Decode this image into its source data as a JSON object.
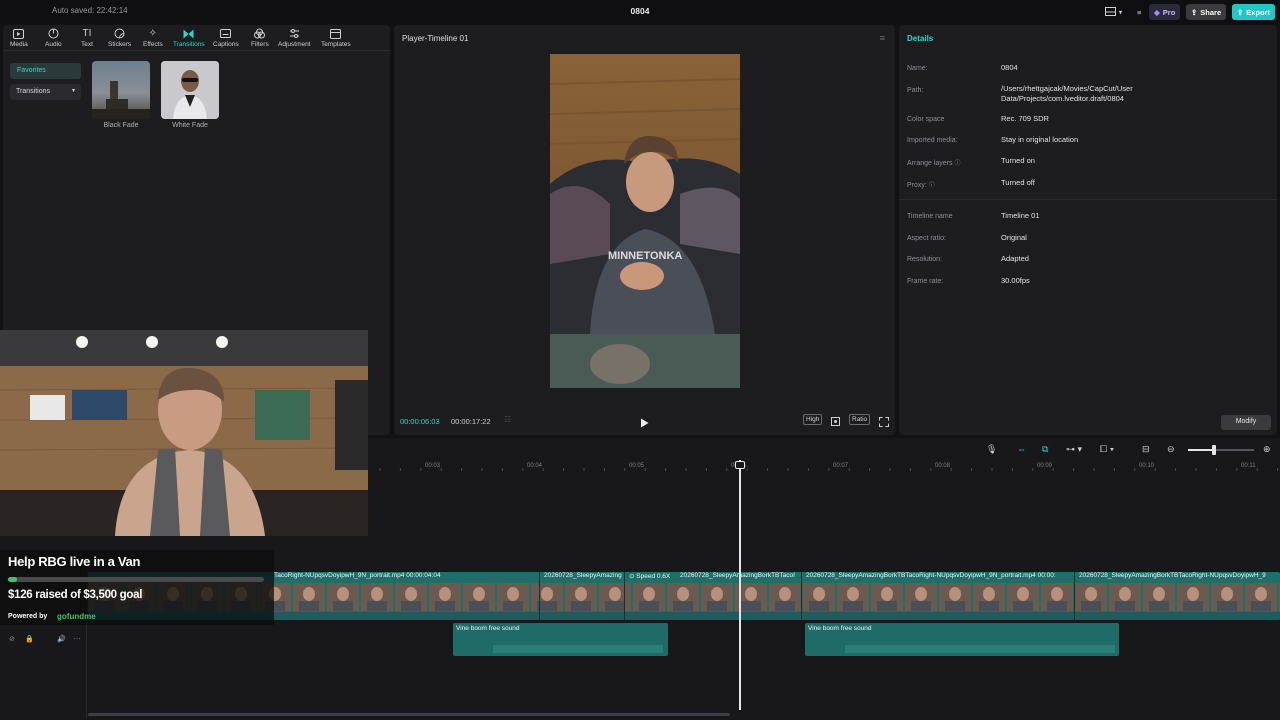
{
  "topbar": {
    "autosave": "Auto saved: 22:42:14",
    "project_title": "0804",
    "pro_label": "Pro",
    "share_label": "Share",
    "export_label": "Export"
  },
  "toolbar": {
    "items": [
      {
        "label": "Media",
        "icon": "media-icon"
      },
      {
        "label": "Audio",
        "icon": "audio-icon"
      },
      {
        "label": "Text",
        "icon": "text-icon"
      },
      {
        "label": "Stickers",
        "icon": "stickers-icon"
      },
      {
        "label": "Effects",
        "icon": "effects-icon"
      },
      {
        "label": "Transitions",
        "icon": "transitions-icon",
        "active": true
      },
      {
        "label": "Captions",
        "icon": "captions-icon"
      },
      {
        "label": "Filters",
        "icon": "filters-icon"
      },
      {
        "label": "Adjustment",
        "icon": "adjustment-icon"
      },
      {
        "label": "Templates",
        "icon": "templates-icon"
      }
    ]
  },
  "left_panel": {
    "favorites": "Favorites",
    "transitions_dropdown": "Transitions",
    "thumbnails": [
      {
        "label": "Black Fade"
      },
      {
        "label": "White Fade"
      }
    ]
  },
  "player": {
    "title": "Player-Timeline 01",
    "current_time": "00:00:06:03",
    "total_time": "00:00:17:22",
    "quality": "High",
    "ratio": "Ratio"
  },
  "details": {
    "title": "Details",
    "rows": [
      {
        "key": "Name:",
        "value": "0804"
      },
      {
        "key": "Path:",
        "value": "/Users/rhettgajcak/Movies/CapCut/User Data/Projects/com.lveditor.draft/0804"
      },
      {
        "key": "Color space",
        "value": "Rec. 709 SDR"
      },
      {
        "key": "Imported media:",
        "value": "Stay in original location"
      },
      {
        "key": "Arrange layers",
        "value": "Turned on"
      },
      {
        "key": "Proxy:",
        "value": "Turned off"
      },
      {
        "key": "Timeline name",
        "value": "Timeline 01"
      },
      {
        "key": "Aspect ratio:",
        "value": "Original"
      },
      {
        "key": "Resolution:",
        "value": "Adapted"
      },
      {
        "key": "Frame rate:",
        "value": "30.00fps"
      }
    ],
    "modify_label": "Modify"
  },
  "timeline": {
    "ticks": [
      "00:03",
      "00:04",
      "00:05",
      "00:06",
      "00:07",
      "00:08",
      "00:09",
      "00:10",
      "00:11"
    ],
    "main_clips": [
      {
        "label": "TacoRight-NUpqsvDoyipwH_9N_portrait.mp4   00:00:04:04"
      },
      {
        "label": "20260728_SleepyAmazing"
      },
      {
        "label": "Speed 0.6X"
      },
      {
        "label": "20260728_SleepyAmazingBorkTBTacoI"
      },
      {
        "label": "20260728_SleepyAmazingBorkTBTacoRight-NUpqsvDoyipwH_9N_portrait.mp4   00:00:"
      },
      {
        "label": "20260728_SleepyAmazingBorkTBTacoRight-NUpqsvDoyipwH_9"
      }
    ],
    "audio_clips": [
      {
        "label": "Vine boom free sound"
      },
      {
        "label": "Vine boom free sound"
      }
    ]
  },
  "gofundme": {
    "title": "Help RBG live in a Van",
    "raised": "$126 raised of $3,500 goal",
    "progress": 0.036,
    "powered_by": "Powered by",
    "logo_text": "gofundme"
  }
}
